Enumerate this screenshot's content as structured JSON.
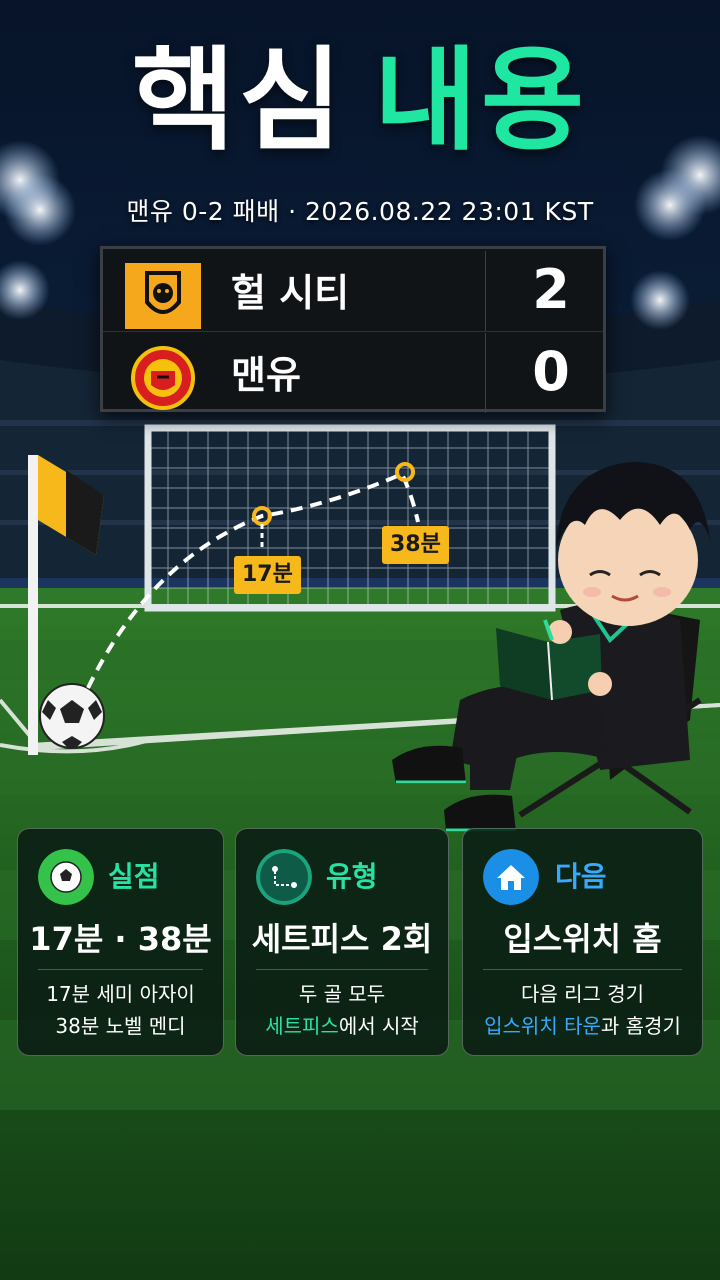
{
  "header": {
    "title_white": "핵심",
    "title_green": "내용",
    "subtitle": "맨유 0-2 패배 · 2026.08.22 23:01 KST"
  },
  "scoreboard": {
    "rows": [
      {
        "team": "헐 시티",
        "score": "2",
        "logo": "hull-city-tiger-crest"
      },
      {
        "team": "맨유",
        "score": "0",
        "logo": "manchester-united-crest"
      }
    ]
  },
  "goal_markers": [
    "17분",
    "38분"
  ],
  "cards": [
    {
      "label": "실점",
      "icon": "soccer-ball-icon",
      "headline": "17분 · 38분",
      "line1": "17분  세미 아자이",
      "line2": "38분  노벨 멘디"
    },
    {
      "label": "유형",
      "icon": "set-piece-route-icon",
      "headline": "세트피스 2회",
      "line1": "두 골 모두",
      "line2_highlight": "세트피스",
      "line2_rest": "에서 시작"
    },
    {
      "label": "다음",
      "icon": "home-icon",
      "headline": "입스위치 홈",
      "line1": "다음 리그 경기",
      "line2_highlight": "입스위치 타운",
      "line2_rest": "과 홈경기"
    }
  ],
  "colors": {
    "accent_green": "#1fe6a0",
    "accent_blue": "#37a9ff",
    "tag_yellow": "#f6b81a",
    "hull_orange": "#f6a81c",
    "united_red": "#d81e1e"
  }
}
